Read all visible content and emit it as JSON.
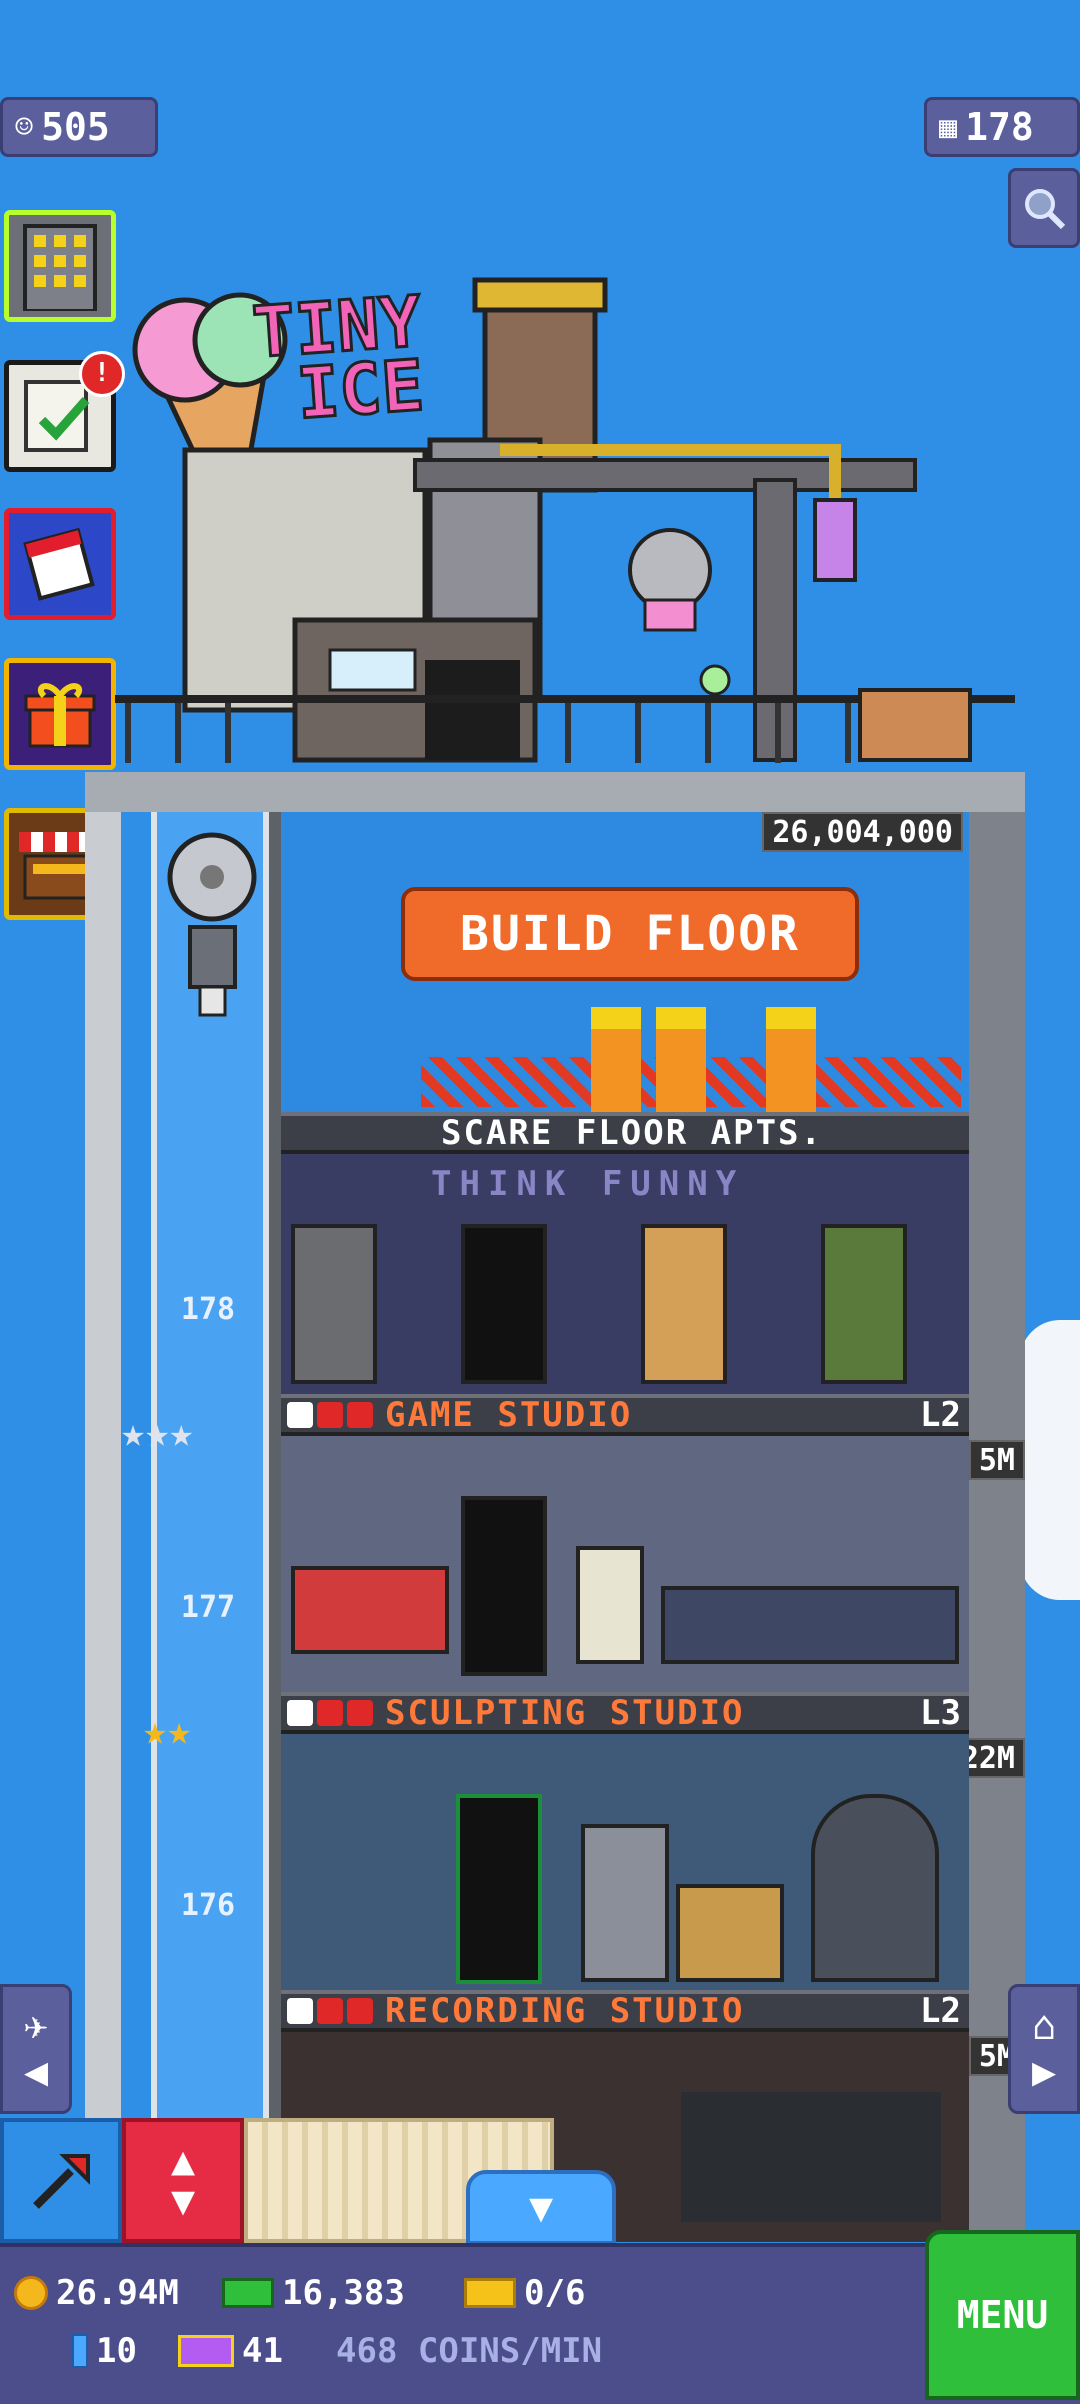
{
  "hud": {
    "population": "505",
    "floors": "178"
  },
  "build": {
    "cost": "26,004,000",
    "button_label": "BUILD FLOOR"
  },
  "floors": [
    {
      "name": "SCARE FLOOR APTS.",
      "level": "",
      "income": "",
      "stars": 0,
      "sign": "THINK FUNNY"
    },
    {
      "name": "GAME STUDIO",
      "level": "L2",
      "income": "5M",
      "stars": 3,
      "number": "178"
    },
    {
      "name": "SCULPTING STUDIO",
      "level": "L3",
      "income": "22M",
      "stars": 2,
      "number": "177"
    },
    {
      "name": "RECORDING STUDIO",
      "level": "L2",
      "income": "5M",
      "stars": 0,
      "number": "176"
    }
  ],
  "footer": {
    "coins": "26.94M",
    "bux": "16,383",
    "tickets": "0/6",
    "keys": "10",
    "tv": "41",
    "rate": "468 COINS/MIN",
    "menu_label": "MENU"
  },
  "notifications": {
    "missions_badge": "!"
  },
  "roof": {
    "logo_line1": "TINY",
    "logo_line2": "ICE"
  },
  "colors": {
    "sky": "#2f8fe6",
    "build_button": "#f06a2a",
    "floor_name": "#ff7a3a",
    "menu": "#2fbf3a"
  }
}
